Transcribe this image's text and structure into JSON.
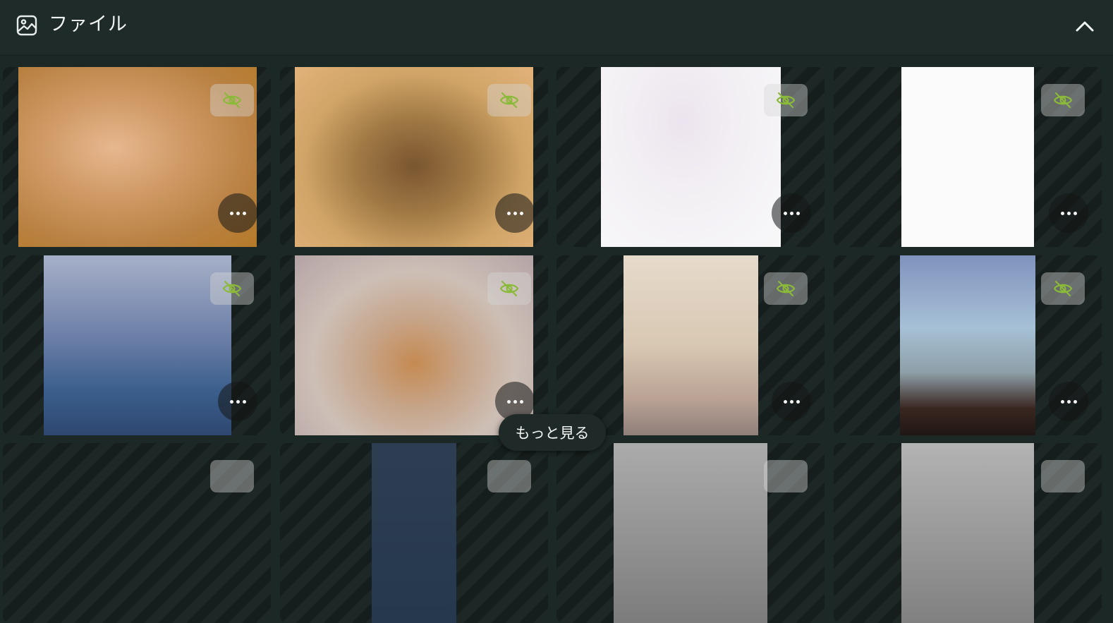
{
  "header": {
    "title": "ファイル",
    "icon": "image-icon",
    "collapse_icon": "chevron-up-icon"
  },
  "tile_controls": {
    "hide_icon": "eye-off-icon",
    "more_icon": "more-horizontal-icon",
    "hide_icon_color": "#8bb93a"
  },
  "tiles": [
    {
      "colors": [
        "#d9a06a",
        "#c48a50",
        "#b98036"
      ]
    },
    {
      "colors": [
        "#e2b27a",
        "#8a6232",
        "#caa250"
      ]
    },
    {
      "colors": [
        "#f4f0f4",
        "#e9e7ec",
        "#f1f1f3"
      ]
    },
    {
      "colors": [
        "#fbfbfb",
        "#f6f6f6",
        "#fafafa"
      ]
    },
    {
      "colors": [
        "#a8b4cc",
        "#5f76a3",
        "#2e4f7c"
      ]
    },
    {
      "colors": [
        "#c7bcb2",
        "#c28a55",
        "#bfb0ad"
      ]
    },
    {
      "colors": [
        "#e3d6c6",
        "#c9b9a6",
        "#9d8b80"
      ]
    },
    {
      "colors": [
        "#8ba2c6",
        "#a7c3d8",
        "#3a2a24"
      ]
    },
    {
      "colors": [
        "#1e2a28",
        "#1e2a28",
        "#1e2a28"
      ]
    },
    {
      "colors": [
        "#2e3e52",
        "#25384e",
        "#1e2a28"
      ]
    },
    {
      "colors": [
        "#aeaeae",
        "#8e8e8e",
        "#6e6e6e"
      ]
    },
    {
      "colors": [
        "#b4b4b4",
        "#949494",
        "#747474"
      ]
    }
  ],
  "see_more": {
    "label": "もっと見る"
  }
}
